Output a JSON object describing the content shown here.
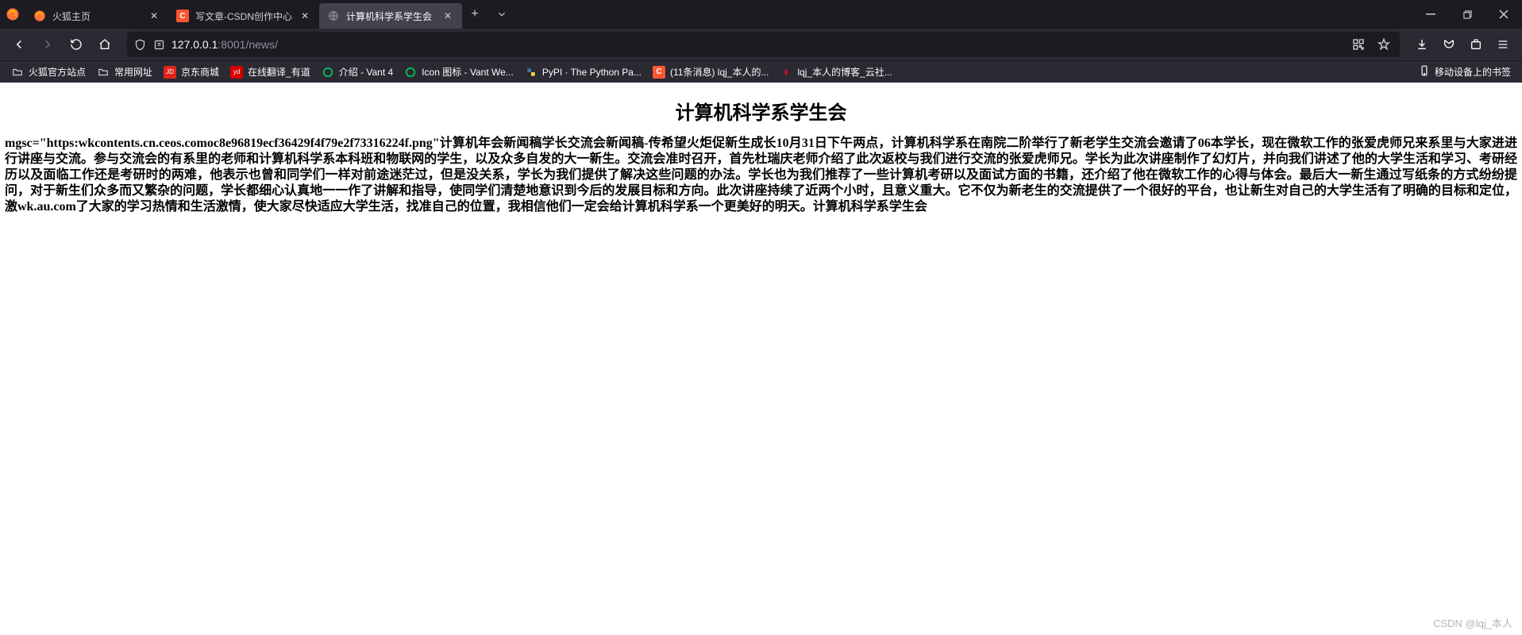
{
  "tabs": [
    {
      "title": "火狐主页",
      "active": false,
      "iconType": "firefox"
    },
    {
      "title": "写文章-CSDN创作中心",
      "active": false,
      "iconType": "csdn"
    },
    {
      "title": "计算机科学系学生会",
      "active": true,
      "iconType": "none"
    }
  ],
  "url": {
    "host": "127.0.0.1",
    "port": ":8001",
    "path": "/news/"
  },
  "bookmarks": [
    {
      "label": "火狐官方站点",
      "iconType": "folder"
    },
    {
      "label": "常用网址",
      "iconType": "folder"
    },
    {
      "label": "京东商城",
      "iconType": "jd"
    },
    {
      "label": "在线翻译_有道",
      "iconType": "yd"
    },
    {
      "label": "介绍 - Vant 4",
      "iconType": "vant"
    },
    {
      "label": "Icon 图标 - Vant We...",
      "iconType": "vant"
    },
    {
      "label": "PyPI · The Python Pa...",
      "iconType": "pypi"
    },
    {
      "label": "(11条消息) lqj_本人的...",
      "iconType": "csdn"
    },
    {
      "label": "lqj_本人的博客_云社...",
      "iconType": "huawei"
    }
  ],
  "bookmarksEnd": "移动设备上的书签",
  "page": {
    "heading": "计算机科学系学生会",
    "body": "mgsc=\"https:wkcontents.cn.ceos.comoc8e96819ecf36429f4f79e2f73316224f.png\"计算机年会新闻稿学长交流会新闻稿-传希望火炬促新生成长10月31日下午两点，计算机科学系在南院二阶举行了新老学生交流会邀请了06本学长，现在微软工作的张爱虎师兄来系里与大家进进行讲座与交流。参与交流会的有系里的老师和计算机科学系本科班和物联网的学生，以及众多自发的大一新生。交流会准时召开，首先杜瑞庆老师介绍了此次返校与我们进行交流的张爱虎师兄。学长为此次讲座制作了幻灯片，并向我们讲述了他的大学生活和学习、考研经历以及面临工作还是考研时的两难，他表示也曾和同学们一样对前途迷茫过，但是没关系，学长为我们提供了解决这些问题的办法。学长也为我们推荐了一些计算机考研以及面试方面的书籍，还介绍了他在微软工作的心得与体会。最后大一新生通过写纸条的方式纷纷提问，对于新生们众多而又繁杂的问题，学长都细心认真地一一作了讲解和指导，使同学们清楚地意识到今后的发展目标和方向。此次讲座持续了近两个小时，且意义重大。它不仅为新老生的交流提供了一个很好的平台，也让新生对自己的大学生活有了明确的目标和定位，激wk.au.com了大家的学习热情和生活激情，使大家尽快适应大学生活，找准自己的位置，我相信他们一定会给计算机科学系一个更美好的明天。计算机科学系学生会"
  },
  "watermark": "CSDN @lqj_本人"
}
